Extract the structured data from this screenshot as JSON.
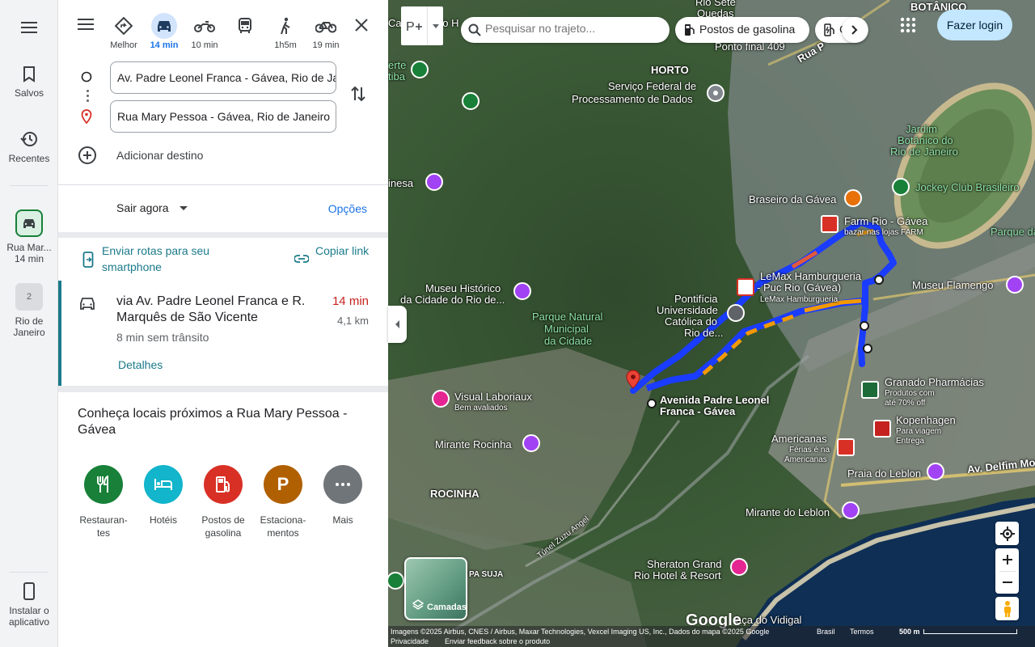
{
  "rail": {
    "saved_label": "Salvos",
    "recent_label": "Recentes",
    "trip_label_line1": "Rua Mar...",
    "trip_label_line2": "14 min",
    "city_badge": "2",
    "city_label_line1": "Rio de",
    "city_label_line2": "Janeiro",
    "install_line1": "Instalar o",
    "install_line2": "aplicativo"
  },
  "modes": [
    {
      "name": "best",
      "label": "Melhor"
    },
    {
      "name": "car",
      "label": "14 min"
    },
    {
      "name": "motorcycle",
      "label": "10 min"
    },
    {
      "name": "transit",
      "label": ""
    },
    {
      "name": "walk",
      "label": "1h5m"
    },
    {
      "name": "bike",
      "label": "19 min"
    }
  ],
  "origin": {
    "value": "Av. Padre Leonel Franca - Gávea, Rio de Janeiro"
  },
  "destination": {
    "value": "Rua Mary Pessoa - Gávea, Rio de Janeiro"
  },
  "add_destination_label": "Adicionar destino",
  "depart": {
    "label": "Sair agora",
    "options_label": "Opções"
  },
  "share": {
    "send_label": "Enviar rotas para seu smartphone",
    "copy_label": "Copiar link"
  },
  "route": {
    "via": "via Av. Padre Leonel Franca e R. Marquês de São Vicente",
    "time": "14 min",
    "distance": "4,1 km",
    "traffic": "8 min sem trânsito",
    "details_label": "Detalhes"
  },
  "nearby": {
    "title": "Conheça locais próximos a Rua Mary Pessoa - Gávea",
    "categories": [
      {
        "label_line1": "Restauran-",
        "label_line2": "tes",
        "color": "#188038",
        "icon": "restaurant-icon"
      },
      {
        "label_line1": "Hotéis",
        "label_line2": "",
        "color": "#12b5cb",
        "icon": "hotel-icon"
      },
      {
        "label_line1": "Postos de",
        "label_line2": "gasolina",
        "color": "#d93025",
        "icon": "gas-station-icon"
      },
      {
        "label_line1": "Estaciona-",
        "label_line2": "mentos",
        "color": "#b06000",
        "icon": "parking-icon"
      },
      {
        "label_line1": "Mais",
        "label_line2": "",
        "color": "#70757a",
        "icon": "more-icon"
      }
    ]
  },
  "map_top": {
    "search_placeholder": "Pesquisar no trajeto...",
    "chip_gas": "Postos de gasolina",
    "chip_ev": "C",
    "login": "Fazer login"
  },
  "map_labels": {
    "botanico": "BOTÂNICO",
    "horto": "HORTO",
    "rio_sete": "Rio Sete",
    "quedas": "Quedas",
    "ponto_final": "Ponto final 409",
    "servico_federal_1": "Serviço Federal de",
    "servico_federal_2": "Processamento de Dados",
    "jardim_1": "Jardim",
    "jardim_2": "Botânico do",
    "jardim_3": "Rio de Janeiro",
    "jockey": "Jockey Club Brasileiro",
    "braseiro": "Braseiro da Gávea",
    "farm_1": "Farm Rio - Gávea",
    "farm_2": "bazar nas lojas FARM",
    "parque_da_gavea": "Parque da",
    "lemax_1": "LeMax Hamburgueria",
    "lemax_2": "- Puc Rio (Gávea)",
    "lemax_3": "LeMax Hamburgueria",
    "museu_flamengo": "Museu Flamengo",
    "museu_hist_1": "Museu Histórico",
    "museu_hist_2": "da Cidade do Rio de...",
    "puc_1": "Pontifícia",
    "puc_2": "Universidade",
    "puc_3": "Católica do",
    "puc_4": "Rio de...",
    "parque_natural_1": "Parque Natural",
    "parque_natural_2": "Municipal",
    "parque_natural_3": "da Cidade",
    "cinesa": "inesa",
    "visual_1": "Visual Laboriaux",
    "visual_2": "Bem avaliados",
    "av_padre_1": "Avenida Padre Leonel",
    "av_padre_2": "Franca - Gávea",
    "granado_1": "Granado Pharmácias",
    "granado_2": "Produtos com",
    "granado_3": "até 70% off",
    "kopenhagen_1": "Kopenhagen",
    "kopenhagen_2": "Para viagem",
    "kopenhagen_3": "Entrega",
    "americanas_1": "Americanas",
    "americanas_2": "Férias é na",
    "americanas_3": "Americanas",
    "mirante_rocinha": "Mirante Rocinha",
    "rocinha": "ROCINHA",
    "praia_leblon": "Praia do Leblon",
    "av_delfim": "Av. Delfim More",
    "mirante_leblon": "Mirante do Leblon",
    "tunel": "Túnel Zuzu Angel",
    "sheraton_1": "Sheraton Grand",
    "sheraton_2": "Rio Hotel & Resort",
    "vidigal": "aça do Vidigal",
    "apa_suja": "PA SUJA",
    "rua_p": "Rua P",
    "ca_top": "Ca",
    "do_h": "do H",
    "tibiria": "tiba",
    "ertre": "erte"
  },
  "layers_label": "Camadas",
  "google_logo": "Google",
  "attribution": {
    "imagery": "Imagens ©2025 Airbus, CNES / Airbus, Maxar Technologies, Vexcel Imaging US, Inc., Dados do mapa ©2025 Google",
    "country": "Brasil",
    "terms": "Termos",
    "scale": "500 m",
    "privacy": "Privacidade",
    "feedback": "Enviar feedback sobre o produto"
  },
  "colors": {
    "accent": "#1a73e8",
    "teal": "#1a7a8a",
    "traffic_red": "#c5221f",
    "route_blue": "#1a3cff",
    "route_orange": "#f29900"
  }
}
